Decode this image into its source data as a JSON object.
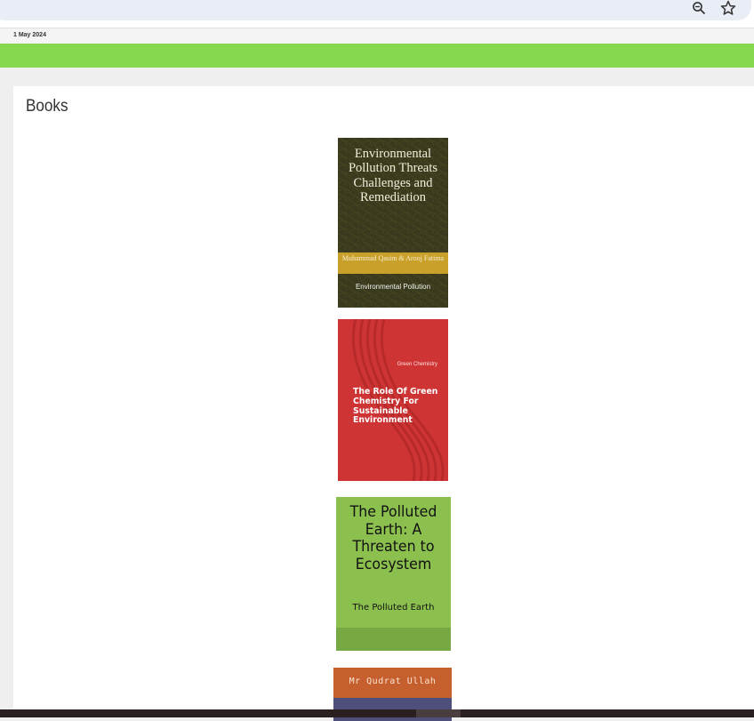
{
  "browser": {
    "icons": [
      "zoom-out-icon",
      "star-icon"
    ]
  },
  "header": {
    "date": "1 May 2024",
    "accent_color": "#86d84f"
  },
  "section": {
    "title": "Books"
  },
  "books": [
    {
      "title": "Environmental Pollution Threats Challenges and Remediation",
      "author": "Muhammad Qasim & Arooj Fatima",
      "subtitle": "Environmental Pollution"
    },
    {
      "tag": "Green Chemistry",
      "title": "The Role Of Green Chemistry For Sustainable Environment"
    },
    {
      "title": "The Polluted Earth: A Threaten to Ecosystem",
      "subtitle": "The Polluted Earth"
    },
    {
      "author": "Mr Qudrat Ullah"
    }
  ]
}
